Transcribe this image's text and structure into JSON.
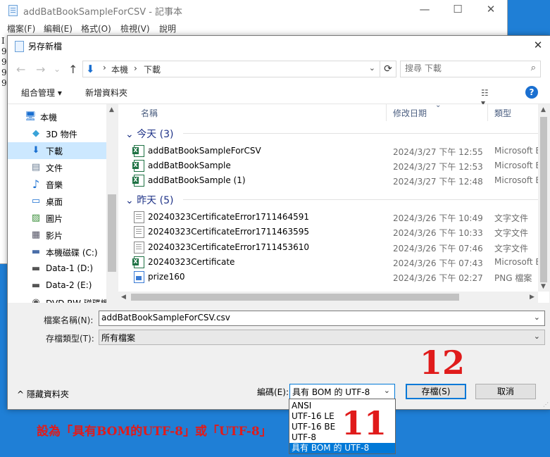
{
  "notepad": {
    "title": "addBatBookSampleForCSV - 記事本",
    "menu": [
      "檔案(F)",
      "編輯(E)",
      "格式(O)",
      "檢視(V)",
      "說明"
    ],
    "side_chars": [
      "I",
      "9",
      "9",
      "9",
      "9"
    ],
    "window_buttons": [
      "—",
      "☐",
      "✕"
    ]
  },
  "dialog": {
    "title": "另存新檔",
    "close": "✕",
    "nav": {
      "back": "←",
      "forward": "→",
      "dropdown": "⌄",
      "up": "↑"
    },
    "address": {
      "crumbs": [
        "本機",
        "下載"
      ],
      "separator": "›",
      "refresh": "⟳"
    },
    "search": {
      "placeholder": "搜尋 下載"
    },
    "toolbar": {
      "organize": "組合管理 ▾",
      "new_folder": "新增資料夾",
      "help": "?"
    },
    "sidebar": [
      {
        "label": "本機",
        "icon": "pc-icon",
        "glyph": "🖥"
      },
      {
        "label": "3D 物件",
        "icon": "cube-icon",
        "glyph": "◆"
      },
      {
        "label": "下載",
        "icon": "download-icon",
        "glyph": "⬇"
      },
      {
        "label": "文件",
        "icon": "document-icon",
        "glyph": "▤"
      },
      {
        "label": "音樂",
        "icon": "music-icon",
        "glyph": "♪"
      },
      {
        "label": "桌面",
        "icon": "desktop-icon",
        "glyph": "▭"
      },
      {
        "label": "圖片",
        "icon": "pictures-icon",
        "glyph": "▨"
      },
      {
        "label": "影片",
        "icon": "video-icon",
        "glyph": "▦"
      },
      {
        "label": "本機磁碟 (C:)",
        "icon": "drive-c-icon",
        "glyph": "▬"
      },
      {
        "label": "Data-1 (D:)",
        "icon": "drive-d-icon",
        "glyph": "▬"
      },
      {
        "label": "Data-2 (E:)",
        "icon": "drive-e-icon",
        "glyph": "▬"
      },
      {
        "label": "DVD RW 磁碟機",
        "icon": "dvd-drive-icon",
        "glyph": "◉"
      }
    ],
    "columns": {
      "name": "名稱",
      "date": "修改日期",
      "type": "類型"
    },
    "groups": [
      {
        "label": "今天 (3)",
        "files": [
          {
            "name": "addBatBookSampleForCSV",
            "date": "2024/3/27 下午 12:55",
            "type": "Microsoft Ex",
            "kind": "excel"
          },
          {
            "name": "addBatBookSample",
            "date": "2024/3/27 下午 12:53",
            "type": "Microsoft Ex",
            "kind": "excel"
          },
          {
            "name": "addBatBookSample (1)",
            "date": "2024/3/27 下午 12:48",
            "type": "Microsoft Ex",
            "kind": "excel"
          }
        ]
      },
      {
        "label": "昨天 (5)",
        "files": [
          {
            "name": "20240323CertificateError1711464591",
            "date": "2024/3/26 下午 10:49",
            "type": "文字文件",
            "kind": "text"
          },
          {
            "name": "20240323CertificateError1711463595",
            "date": "2024/3/26 下午 10:33",
            "type": "文字文件",
            "kind": "text"
          },
          {
            "name": "20240323CertificateError1711453610",
            "date": "2024/3/26 下午 07:46",
            "type": "文字文件",
            "kind": "text"
          },
          {
            "name": "20240323Certificate",
            "date": "2024/3/26 下午 07:43",
            "type": "Microsoft Ex",
            "kind": "excel"
          },
          {
            "name": "prize160",
            "date": "2024/3/26 下午 02:27",
            "type": "PNG 檔案",
            "kind": "png"
          }
        ]
      }
    ],
    "file_name_label": "檔案名稱(N):",
    "file_name_value": "addBatBookSampleForCSV.csv",
    "file_type_label": "存檔類型(T):",
    "file_type_value": "所有檔案",
    "hide_folders": "^  隱藏資料夾",
    "encoding_label": "編碼(E):",
    "encoding_value": "具有 BOM 的 UTF-8",
    "encoding_options": [
      "ANSI",
      "UTF-16 LE",
      "UTF-16 BE",
      "UTF-8",
      "具有 BOM 的 UTF-8"
    ],
    "save_button": "存檔(S)",
    "cancel_button": "取消"
  },
  "annotations": {
    "num_save": "12",
    "num_encoding": "11",
    "note": "設為「具有BOM的UTF-8」或「UTF-8」",
    "color": "#e01b1b"
  }
}
